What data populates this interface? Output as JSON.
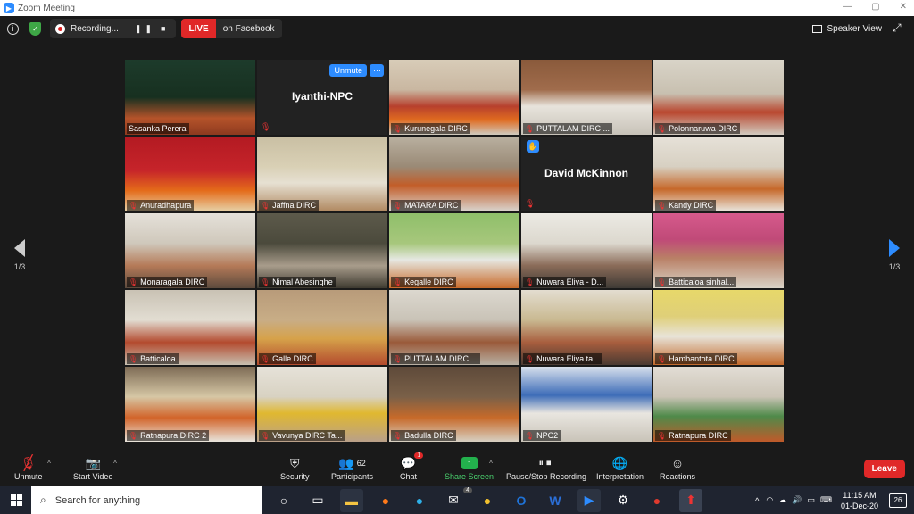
{
  "window": {
    "title": "Zoom Meeting"
  },
  "topbar": {
    "recording_label": "Recording...",
    "live_label": "LIVE",
    "live_target": "on Facebook",
    "view_label": "Speaker View"
  },
  "pager": {
    "left": "1/3",
    "right": "1/3"
  },
  "tiles": [
    {
      "name": "Sasanka Perera"
    },
    {
      "name": "Iyanthi-NPC",
      "unmute": "Unmute",
      "more": "···"
    },
    {
      "name": "Kurunegala DIRC"
    },
    {
      "name": "PUTTALAM DIRC ..."
    },
    {
      "name": "Polonnaruwa DIRC"
    },
    {
      "name": "Anuradhapura"
    },
    {
      "name": "Jaffna DIRC"
    },
    {
      "name": "MATARA DIRC"
    },
    {
      "name": "David McKinnon"
    },
    {
      "name": "Kandy DIRC"
    },
    {
      "name": "Monaragala DIRC"
    },
    {
      "name": "Nimal Abesinghe"
    },
    {
      "name": "Kegalle DIRC"
    },
    {
      "name": "Nuwara Eliya - D..."
    },
    {
      "name": "Batticaloa sinhal..."
    },
    {
      "name": "Batticaloa"
    },
    {
      "name": "Galle DIRC"
    },
    {
      "name": "PUTTALAM DIRC ..."
    },
    {
      "name": "Nuwara Eliya ta..."
    },
    {
      "name": "Hambantota DIRC"
    },
    {
      "name": "Ratnapura DIRC 2"
    },
    {
      "name": "Vavunya DIRC Ta..."
    },
    {
      "name": "Badulla DIRC"
    },
    {
      "name": "NPC2"
    },
    {
      "name": "Ratnapura DIRC"
    }
  ],
  "toolbar": {
    "unmute": "Unmute",
    "start_video": "Start Video",
    "security": "Security",
    "participants": "Participants",
    "participants_count": "62",
    "chat": "Chat",
    "chat_badge": "1",
    "share_screen": "Share Screen",
    "pause_stop": "Pause/Stop Recording",
    "interpretation": "Interpretation",
    "reactions": "Reactions",
    "leave": "Leave"
  },
  "taskbar": {
    "search_placeholder": "Search for anything",
    "mail_badge": "4",
    "time": "11:15 AM",
    "date": "01-Dec-20",
    "notifications": "26"
  },
  "colors": {
    "accent": "#2d8cff",
    "live_red": "#e02828",
    "share_green": "#23b14d",
    "active_speaker": "#f3e94a"
  }
}
